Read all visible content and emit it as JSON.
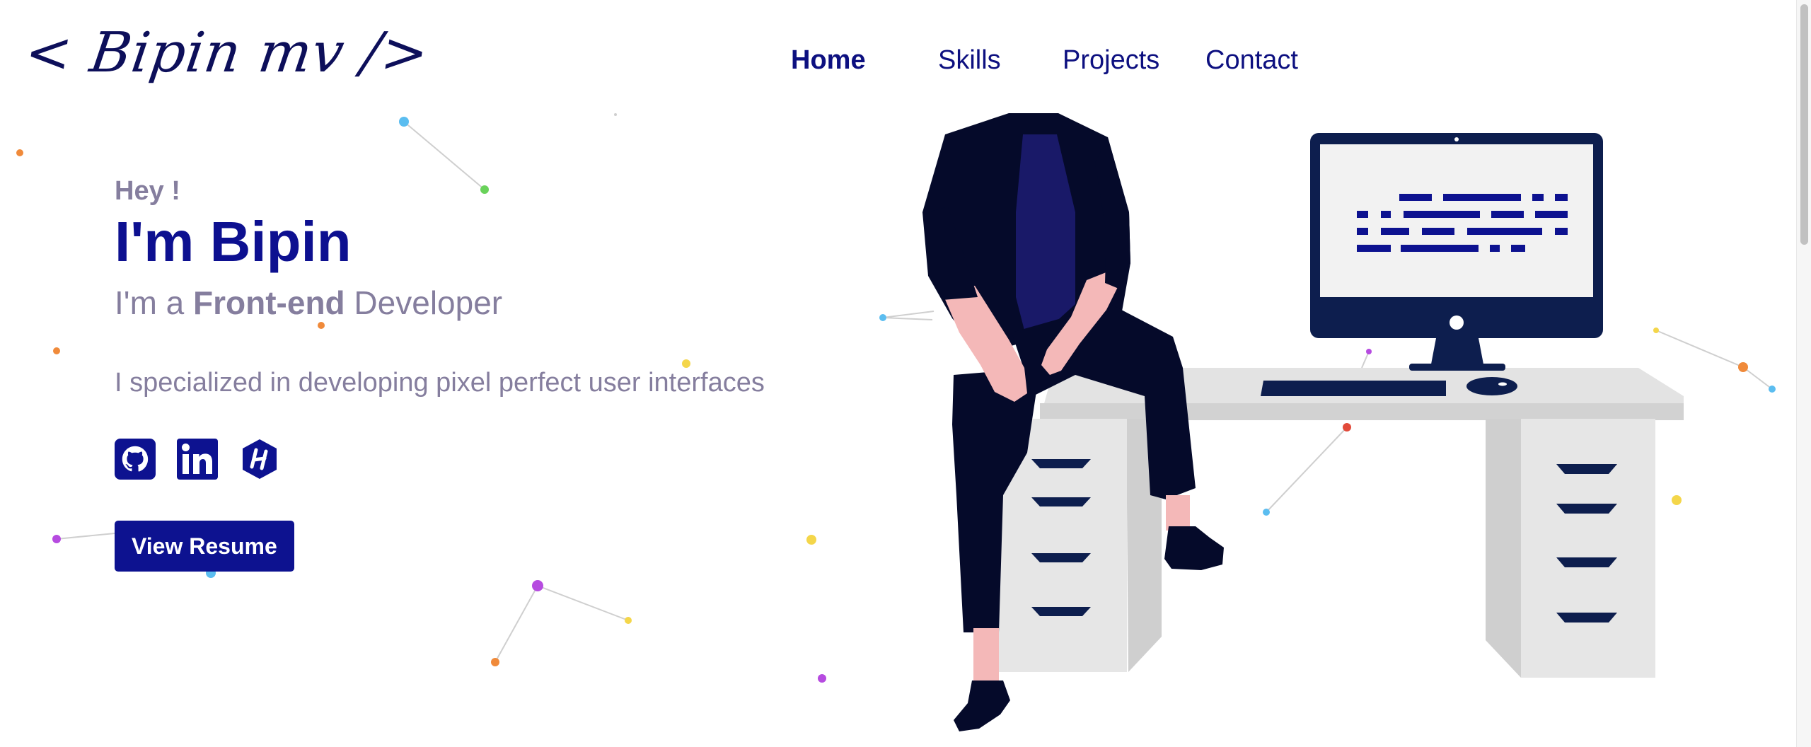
{
  "header": {
    "logo_text": "< Bipin mv />",
    "nav": [
      {
        "label": "Home",
        "active": true
      },
      {
        "label": "Skills",
        "active": false
      },
      {
        "label": "Projects",
        "active": false
      },
      {
        "label": "Contact",
        "active": false
      }
    ]
  },
  "hero": {
    "greeting": "Hey !",
    "name": "I'm Bipin",
    "role_prefix": "I'm a ",
    "role_highlight": "Front-end",
    "role_suffix": " Developer",
    "description": "I specialized in developing pixel perfect user interfaces",
    "socials": [
      {
        "icon": "github-icon"
      },
      {
        "icon": "linkedin-icon"
      },
      {
        "icon": "hackerrank-icon"
      }
    ],
    "resume_button": "View Resume"
  },
  "colors": {
    "primary": "#0d1290",
    "text_muted": "#857e9e",
    "background": "#ffffff"
  }
}
